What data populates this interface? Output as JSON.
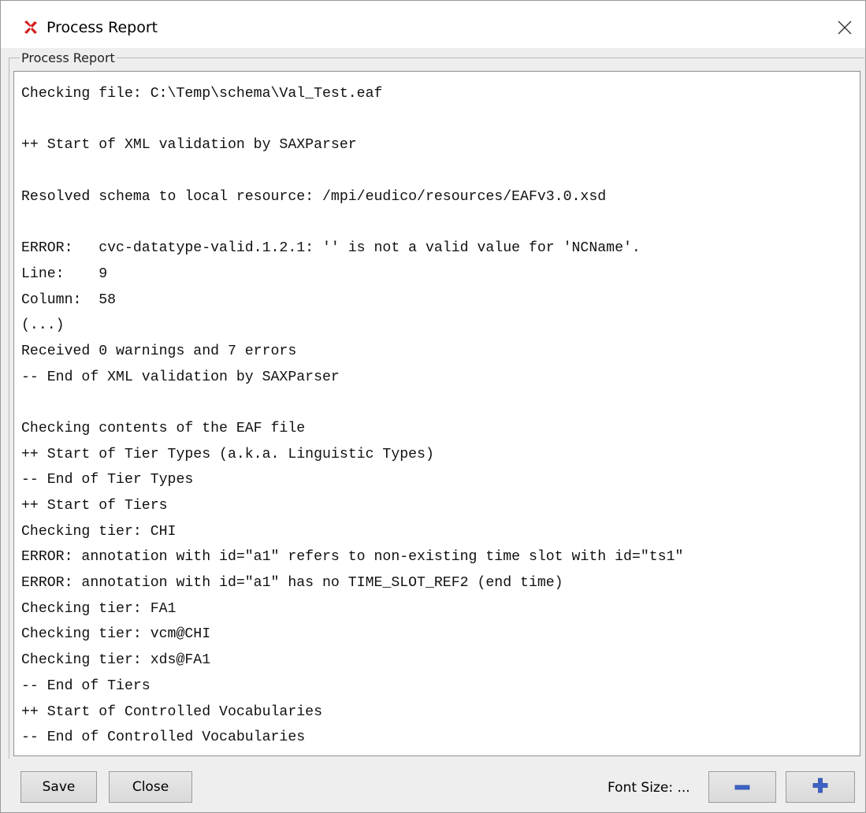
{
  "window": {
    "title": "Process Report",
    "icon": "elan-app-icon",
    "close_icon": "close-icon"
  },
  "group": {
    "label": "Process Report"
  },
  "report_lines": [
    "Checking file: C:\\Temp\\schema\\Val_Test.eaf",
    "",
    "++ Start of XML validation by SAXParser",
    "",
    "Resolved schema to local resource: /mpi/eudico/resources/EAFv3.0.xsd",
    "",
    "ERROR:   cvc-datatype-valid.1.2.1: '' is not a valid value for 'NCName'.",
    "Line:    9",
    "Column:  58",
    "(...)",
    "Received 0 warnings and 7 errors",
    "-- End of XML validation by SAXParser",
    "",
    "Checking contents of the EAF file",
    "++ Start of Tier Types (a.k.a. Linguistic Types)",
    "-- End of Tier Types",
    "++ Start of Tiers",
    "Checking tier: CHI",
    "ERROR: annotation with id=\"a1\" refers to non-existing time slot with id=\"ts1\"",
    "ERROR: annotation with id=\"a1\" has no TIME_SLOT_REF2 (end time)",
    "Checking tier: FA1",
    "Checking tier: vcm@CHI",
    "Checking tier: xds@FA1",
    "-- End of Tiers",
    "++ Start of Controlled Vocabularies",
    "-- End of Controlled Vocabularies"
  ],
  "footer": {
    "save_label": "Save",
    "close_label": "Close",
    "font_size_label": "Font Size: ...",
    "decrease_icon": "minus-icon",
    "increase_icon": "plus-icon"
  },
  "colors": {
    "button_icon_blue": "#3d63c7",
    "app_icon_red": "#d42020"
  }
}
